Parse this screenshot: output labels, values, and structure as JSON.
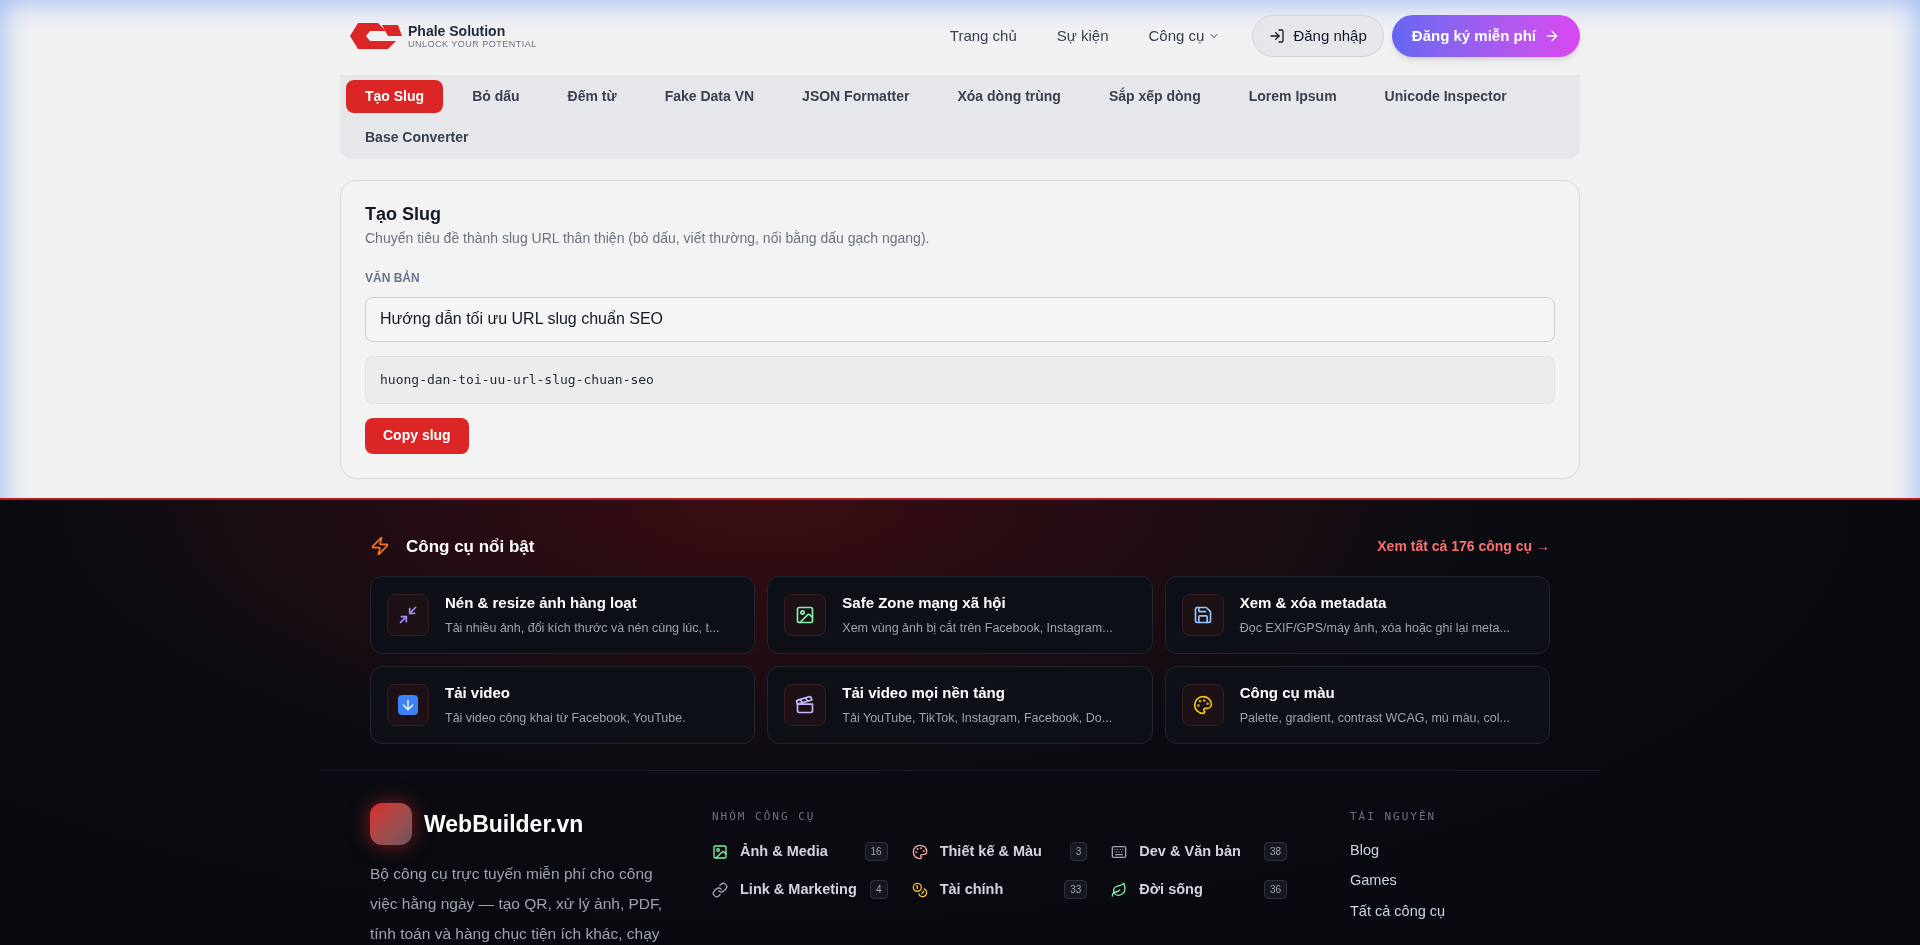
{
  "header": {
    "logo": {
      "name": "Phale Solution",
      "tagline": "UNLOCK YOUR POTENTIAL"
    },
    "nav": [
      {
        "label": "Trang chủ",
        "kind": "link"
      },
      {
        "label": "Sự kiện",
        "kind": "link"
      },
      {
        "label": "Công cụ",
        "kind": "dropdown"
      }
    ],
    "login": "Đăng nhập",
    "signup": "Đăng ký miễn phí"
  },
  "tool_tabs": [
    {
      "label": "Tạo Slug",
      "selected": true
    },
    {
      "label": "Bỏ dấu",
      "selected": false
    },
    {
      "label": "Đếm từ",
      "selected": false
    },
    {
      "label": "Fake Data VN",
      "selected": false
    },
    {
      "label": "JSON Formatter",
      "selected": false
    },
    {
      "label": "Xóa dòng trùng",
      "selected": false
    },
    {
      "label": "Sắp xếp dòng",
      "selected": false
    },
    {
      "label": "Lorem Ipsum",
      "selected": false
    },
    {
      "label": "Unicode Inspector",
      "selected": false
    },
    {
      "label": "Base Converter",
      "selected": false
    }
  ],
  "tool_card": {
    "title": "Tạo Slug",
    "description": "Chuyển tiêu đề thành slug URL thân thiện (bỏ dấu, viết thường, nối bằng dấu gạch ngang).",
    "field_label": "VĂN BẢN",
    "input": "Hướng dẫn tối ưu URL slug chuẩn SEO",
    "output": "huong-dan-toi-uu-url-slug-chuan-seo",
    "button": "Copy slug"
  },
  "featured": {
    "title": "Công cụ nổi bật",
    "see_all": "Xem tất cả 176 công cụ →",
    "tools": [
      {
        "title": "Nén & resize ảnh hàng loạt",
        "description": "Tải nhiều ảnh, đổi kích thước và nén cùng lúc, t..."
      },
      {
        "title": "Safe Zone mạng xã hội",
        "description": "Xem vùng ảnh bị cắt trên Facebook, Instagram..."
      },
      {
        "title": "Xem & xóa metadata",
        "description": "Đọc EXIF/GPS/máy ảnh, xóa hoặc ghi lại meta..."
      },
      {
        "title": "Tải video",
        "description": "Tải video công khai từ Facebook, YouTube."
      },
      {
        "title": "Tải video mọi nền tảng",
        "description": "Tải YouTube, TikTok, Instagram, Facebook, Do..."
      },
      {
        "title": "Công cụ màu",
        "description": "Palette, gradient, contrast WCAG, mù màu, col..."
      }
    ]
  },
  "footer": {
    "brand": "WebBuilder.vn",
    "description": "Bộ công cụ trực tuyến miễn phí cho công việc hằng ngày — tạo QR, xử lý ảnh, PDF, tính toán và hàng chục tiện ích khác, chạy",
    "groups_title": "NHÓM CÔNG CỤ",
    "groups": [
      {
        "label": "Ảnh & Media",
        "count": "16"
      },
      {
        "label": "Thiết kế & Màu",
        "count": "3"
      },
      {
        "label": "Dev & Văn bản",
        "count": "38"
      },
      {
        "label": "Link & Marketing",
        "count": "4"
      },
      {
        "label": "Tài chính",
        "count": "33"
      },
      {
        "label": "Đời sống",
        "count": "36"
      }
    ],
    "resources_title": "TÀI NGUYÊN",
    "resources": [
      "Blog",
      "Games",
      "Tất cả công cụ"
    ]
  }
}
